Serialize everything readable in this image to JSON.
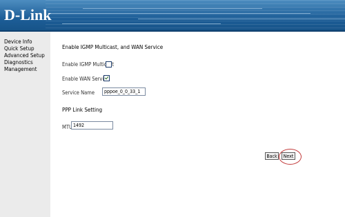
{
  "header": {
    "logo_text": "D-Link"
  },
  "sidebar": {
    "items": [
      {
        "label": "Device Info"
      },
      {
        "label": "Quick Setup"
      },
      {
        "label": "Advanced Setup"
      },
      {
        "label": "Diagnostics"
      },
      {
        "label": "Management"
      }
    ]
  },
  "main": {
    "section_title": "Enable IGMP Multicast, and WAN Service",
    "igmp": {
      "label": "Enable IGMP Multicast",
      "checked": false
    },
    "wan_service": {
      "label": "Enable WAN Service",
      "checked": true
    },
    "service_name": {
      "label": "Service Name",
      "value": "pppoe_0_0_33_1"
    },
    "ppp_title": "PPP Link Setting",
    "mtu": {
      "label": "MTU",
      "value": "1492"
    },
    "back_label": "Back",
    "next_label": "Next"
  },
  "colors": {
    "header_blue": "#1d5e98",
    "sidebar_bg": "#ebebeb",
    "highlight": "#c23a3a"
  }
}
